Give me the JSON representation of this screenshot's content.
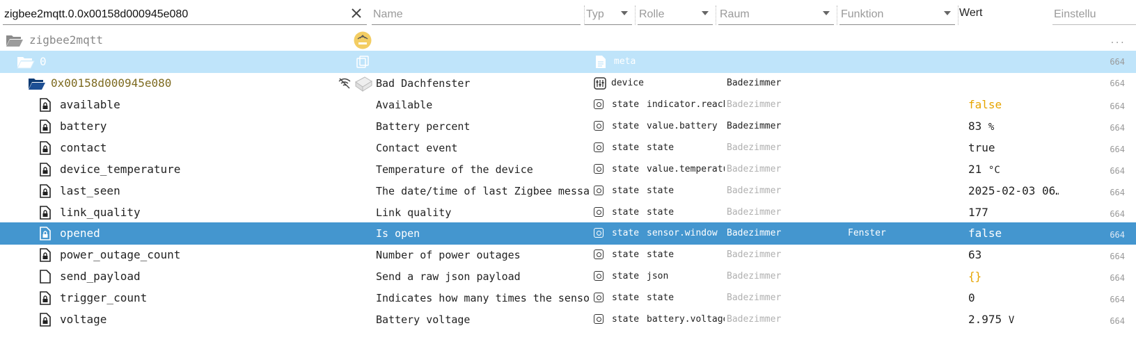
{
  "filter": {
    "id_value": "zigbee2mqtt.0.0x00158d000945e080",
    "name_placeholder": "Name",
    "type_placeholder": "Typ",
    "role_placeholder": "Rolle",
    "room_placeholder": "Raum",
    "function_placeholder": "Funktion",
    "value_label": "Wert",
    "settings_label": "Einstellu"
  },
  "tree": {
    "root": {
      "id": "zigbee2mqtt",
      "acc": "..."
    },
    "instance": {
      "id": "0",
      "type": "meta",
      "acc": "664"
    },
    "device": {
      "id": "0x00158d000945e080",
      "name": "Bad Dachfenster",
      "type": "device",
      "room": "Badezimmer",
      "acc": "664"
    },
    "states": [
      {
        "id": "available",
        "name": "Available",
        "type": "state",
        "role": "indicator.reach…",
        "room": "Badezimmer",
        "room_muted": true,
        "function": "",
        "value": "false",
        "value_style": "orange",
        "unit": "",
        "acc": "664",
        "locked": true
      },
      {
        "id": "battery",
        "name": "Battery percent",
        "type": "state",
        "role": "value.battery",
        "room": "Badezimmer",
        "room_muted": false,
        "function": "",
        "value": "83",
        "value_style": "",
        "unit": "%",
        "acc": "664",
        "locked": true
      },
      {
        "id": "contact",
        "name": "Contact event",
        "type": "state",
        "role": "state",
        "room": "Badezimmer",
        "room_muted": true,
        "function": "",
        "value": "true",
        "value_style": "",
        "unit": "",
        "acc": "664",
        "locked": true
      },
      {
        "id": "device_temperature",
        "name": "Temperature of the device",
        "type": "state",
        "role": "value.temperatu…",
        "room": "Badezimmer",
        "room_muted": true,
        "function": "",
        "value": "21",
        "value_style": "",
        "unit": "°C",
        "acc": "664",
        "locked": true
      },
      {
        "id": "last_seen",
        "name": "The date/time of last Zigbee message",
        "type": "state",
        "role": "state",
        "room": "Badezimmer",
        "room_muted": true,
        "function": "",
        "value": "2025-02-03 06…",
        "value_style": "",
        "unit": "",
        "acc": "664",
        "locked": true
      },
      {
        "id": "link_quality",
        "name": "Link quality",
        "type": "state",
        "role": "state",
        "room": "Badezimmer",
        "room_muted": true,
        "function": "",
        "value": "177",
        "value_style": "",
        "unit": "",
        "acc": "664",
        "locked": true
      },
      {
        "id": "opened",
        "name": "Is open",
        "type": "state",
        "role": "sensor.window",
        "room": "Badezimmer",
        "room_muted": false,
        "function": "Fenster",
        "value": "false",
        "value_style": "",
        "unit": "",
        "acc": "664",
        "locked": true,
        "selected": true
      },
      {
        "id": "power_outage_count",
        "name": "Number of power outages",
        "type": "state",
        "role": "state",
        "room": "Badezimmer",
        "room_muted": true,
        "function": "",
        "value": "63",
        "value_style": "",
        "unit": "",
        "acc": "664",
        "locked": true
      },
      {
        "id": "send_payload",
        "name": "Send a raw json payload",
        "type": "state",
        "role": "json",
        "room": "Badezimmer",
        "room_muted": true,
        "function": "",
        "value": "{}",
        "value_style": "orange",
        "unit": "",
        "acc": "664",
        "locked": false
      },
      {
        "id": "trigger_count",
        "name": "Indicates how many times the sensor w…",
        "type": "state",
        "role": "state",
        "room": "Badezimmer",
        "room_muted": true,
        "function": "",
        "value": "0",
        "value_style": "",
        "unit": "",
        "acc": "664",
        "locked": true
      },
      {
        "id": "voltage",
        "name": "Battery voltage",
        "type": "state",
        "role": "battery.voltage",
        "room": "Badezimmer",
        "room_muted": true,
        "function": "",
        "value": "2.975",
        "value_style": "",
        "unit": "V",
        "acc": "664",
        "locked": true
      }
    ]
  },
  "icons": {
    "folder_open": "folder-open-icon",
    "file_locked": "file-lock-icon",
    "file": "file-icon",
    "state": "state-icon",
    "meta": "meta-file-icon",
    "device": "device-icon",
    "clear": "close-icon",
    "copy": "copy-icon",
    "no_wifi": "wifi-off-icon",
    "adapter_logo": "mqtt-logo-icon"
  }
}
